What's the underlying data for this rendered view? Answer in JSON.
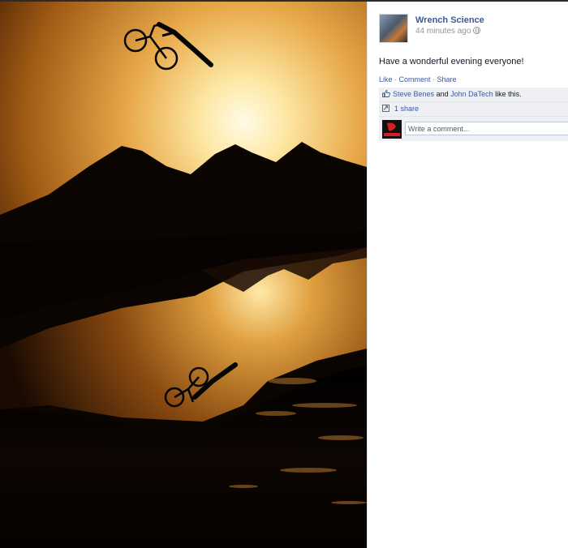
{
  "post": {
    "page_name": "Wrench Science",
    "timestamp": "44 minutes ago",
    "privacy_icon": "globe-icon",
    "message": "Have a wonderful evening everyone!",
    "actions": {
      "like": "Like",
      "comment": "Comment",
      "share": "Share",
      "separator": " · "
    }
  },
  "ufi": {
    "likers": [
      "Steve Benes",
      "John DaTech"
    ],
    "likes_joiner": "and",
    "likes_suffix": "like this.",
    "shares_label": "1 share",
    "comment_placeholder": "Write a comment..."
  },
  "photo": {
    "description_icon": "bmx-silhouette-photo"
  },
  "colors": {
    "link": "#3b5998",
    "ufi_background": "#eef0f4",
    "meta_text": "#90949c"
  }
}
